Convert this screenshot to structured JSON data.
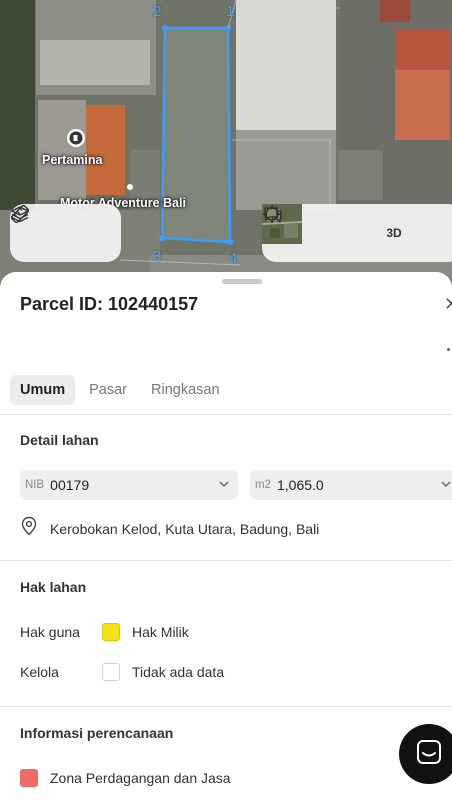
{
  "map": {
    "labels": {
      "poi_pertamina": "Pertamina",
      "poi_motor": "Motor Adventure Bali"
    },
    "vertices": [
      "1",
      "2",
      "3",
      "4"
    ],
    "controls": {
      "layers_icon": "layers-icon",
      "measure_icon": "ruler-icon",
      "basemap_icon": "satellite-thumbnail",
      "locate_icon": "crosshair-icon",
      "threed_label": "3D",
      "feedback_icon": "comment-icon"
    },
    "colors": {
      "parcel_outline": "#3b9cff"
    }
  },
  "sheet": {
    "title": "Parcel ID: 102440157",
    "tabs": [
      {
        "label": "Umum",
        "active": true
      },
      {
        "label": "Pasar",
        "active": false
      },
      {
        "label": "Ringkasan",
        "active": false
      }
    ],
    "detail": {
      "heading": "Detail lahan",
      "nib_prefix": "NIB",
      "nib_value": "00179",
      "area_prefix": "m2",
      "area_value": "1,065.0",
      "location": "Kerobokan Kelod, Kuta Utara, Badung, Bali"
    },
    "rights": {
      "heading": "Hak lahan",
      "rows": [
        {
          "label": "Hak guna",
          "value": "Hak Milik",
          "color": "#f7e21a"
        },
        {
          "label": "Kelola",
          "value": "Tidak ada data",
          "color": "#ffffff"
        }
      ]
    },
    "planning": {
      "heading": "Informasi perencanaan",
      "zone_label": "Zona Perdagangan dan Jasa",
      "zone_color": "#f06a6a"
    }
  }
}
